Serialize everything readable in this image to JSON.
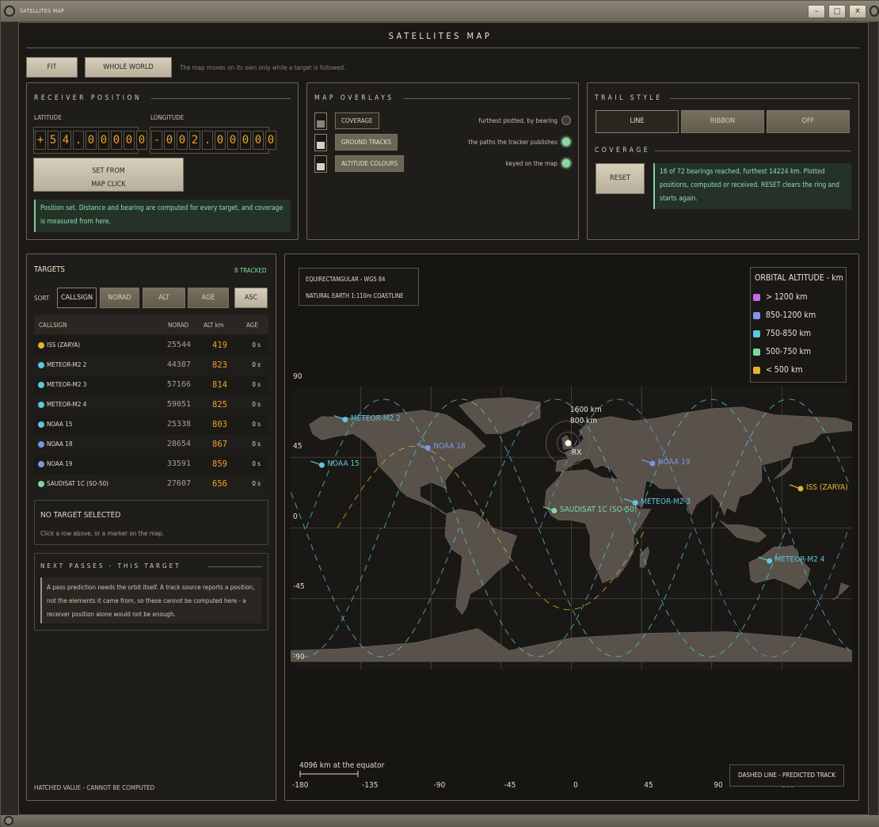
{
  "window": {
    "title": "SATELLITES MAP",
    "app_title": "SATELLITES MAP"
  },
  "toolbar": {
    "fit": "FIT",
    "whole_world": "WHOLE WORLD",
    "hint": "The map moves on its own only while a target is followed."
  },
  "receiver": {
    "heading": "RECEIVER POSITION",
    "lat_label": "LATITUDE",
    "lon_label": "LONGITUDE",
    "lat_digits": [
      "+",
      "5",
      "4",
      ".",
      "0",
      "0",
      "0",
      "0",
      "0"
    ],
    "lon_digits": [
      "-",
      "0",
      "0",
      "2",
      ".",
      "0",
      "0",
      "0",
      "0",
      "0"
    ],
    "set_button_line1": "SET FROM",
    "set_button_line2": "MAP CLICK",
    "note": "Position set. Distance and bearing are computed for every target, and coverage is measured from here."
  },
  "overlays": {
    "heading": "MAP OVERLAYS",
    "items": [
      {
        "label": "COVERAGE",
        "desc": "furthest plotted, by bearing",
        "on": false
      },
      {
        "label": "GROUND TRACKS",
        "desc": "the paths the tracker publishes",
        "on": true
      },
      {
        "label": "ALTITUDE COLOURS",
        "desc": "keyed on the map",
        "on": true
      }
    ]
  },
  "trail": {
    "heading": "TRAIL STYLE",
    "options": [
      "LINE",
      "RIBBON",
      "OFF"
    ],
    "selected": "LINE"
  },
  "coverage": {
    "heading": "COVERAGE",
    "reset": "RESET",
    "note": "16 of 72 bearings reached, furthest 14224 km. Plotted positions, computed or received. RESET clears the ring and starts again."
  },
  "targets": {
    "title": "TARGETS",
    "tracked": "8 TRACKED",
    "sort_label": "SORT",
    "sort_options": [
      "CALLSIGN",
      "NORAD",
      "ALT",
      "AGE"
    ],
    "order": "ASC",
    "columns": [
      "CALLSIGN",
      "NORAD",
      "ALT km",
      "AGE"
    ],
    "rows": [
      {
        "callsign": "ISS (ZARYA)",
        "norad": "25544",
        "alt": "419",
        "age": "0 s",
        "color": "#e8b230"
      },
      {
        "callsign": "METEOR-M2 2",
        "norad": "44387",
        "alt": "823",
        "age": "0 s",
        "color": "#5ac8e0"
      },
      {
        "callsign": "METEOR-M2 3",
        "norad": "57166",
        "alt": "814",
        "age": "0 s",
        "color": "#5ac8e0"
      },
      {
        "callsign": "METEOR-M2 4",
        "norad": "59051",
        "alt": "825",
        "age": "0 s",
        "color": "#5ac8e0"
      },
      {
        "callsign": "NOAA 15",
        "norad": "25338",
        "alt": "803",
        "age": "0 s",
        "color": "#5ac8e0"
      },
      {
        "callsign": "NOAA 18",
        "norad": "28654",
        "alt": "867",
        "age": "0 s",
        "color": "#7a98e8"
      },
      {
        "callsign": "NOAA 19",
        "norad": "33591",
        "alt": "859",
        "age": "0 s",
        "color": "#7a98e8"
      },
      {
        "callsign": "SAUDISAT 1C (SO-50)",
        "norad": "27607",
        "alt": "656",
        "age": "0 s",
        "color": "#7ed8a0"
      }
    ],
    "no_target_title": "NO TARGET SELECTED",
    "no_target_hint": "Click a row above, or a marker on the map.",
    "passes_heading": "NEXT PASSES - THIS TARGET",
    "passes_note": "A pass prediction needs the orbit itself. A track source reports a position, not the elements it came from, so these cannot be computed here - a receiver position alone would not be enough.",
    "footer": "HATCHED VALUE - CANNOT BE COMPUTED"
  },
  "map": {
    "projection": "EQUIRECTANGULAR - WGS 84",
    "coastline": "NATURAL EARTH 1:110m COASTLINE",
    "legend_title": "ORBITAL ALTITUDE - km",
    "legend": [
      {
        "label": "> 1200 km",
        "color": "#c86ae0"
      },
      {
        "label": "850-1200 km",
        "color": "#7a98e8"
      },
      {
        "label": "750-850 km",
        "color": "#5ac8e0"
      },
      {
        "label": "500-750 km",
        "color": "#7ed8a0"
      },
      {
        "label": "< 500 km",
        "color": "#e8b230"
      }
    ],
    "lat_ticks": [
      "90",
      "45",
      "0",
      "-45",
      "-90"
    ],
    "lon_ticks": [
      "-180",
      "-135",
      "-90",
      "-45",
      "0",
      "45",
      "90",
      "135"
    ],
    "range_rings": [
      "1600 km",
      "800 km"
    ],
    "receiver_label": "RX",
    "scale": "4096 km at the equator",
    "dashed_note": "DASHED LINE - PREDICTED TRACK",
    "markers": [
      {
        "name": "METEOR-M2 2",
        "lon": -145,
        "lat": 69,
        "color": "#5ac8e0"
      },
      {
        "name": "NOAA 18",
        "lon": -92,
        "lat": 51,
        "color": "#7a98e8"
      },
      {
        "name": "NOAA 15",
        "lon": -160,
        "lat": 40,
        "color": "#5ac8e0"
      },
      {
        "name": "NOAA 19",
        "lon": 52,
        "lat": 41,
        "color": "#7a98e8"
      },
      {
        "name": "METEOR-M2 3",
        "lon": 41,
        "lat": 16,
        "color": "#5ac8e0"
      },
      {
        "name": "SAUDISAT 1C (SO-50)",
        "lon": -11,
        "lat": 11,
        "color": "#7ed8a0"
      },
      {
        "name": "ISS (ZARYA)",
        "lon": 147,
        "lat": 25,
        "color": "#e8b230"
      },
      {
        "name": "METEOR-M2 4",
        "lon": 127,
        "lat": -21,
        "color": "#5ac8e0"
      }
    ]
  }
}
